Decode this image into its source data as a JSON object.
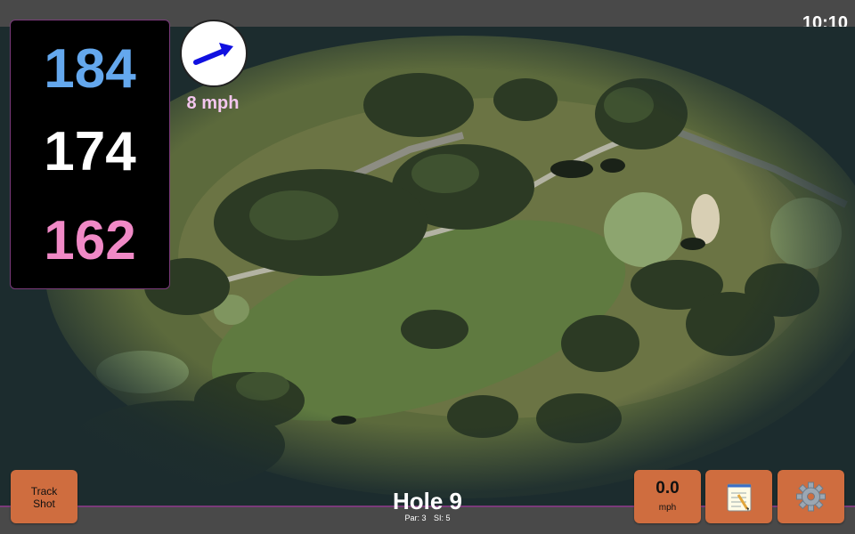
{
  "status": {
    "time": "10:10"
  },
  "distances": {
    "back": "184",
    "middle": "174",
    "front": "162"
  },
  "wind": {
    "speed_label": "8 mph",
    "direction_icon": "arrow-up-right-icon",
    "arrow_color": "#1010e0"
  },
  "hole": {
    "title": "Hole 9",
    "par_label": "Par: 3",
    "si_label": "SI: 5"
  },
  "buttons": {
    "track_shot_label": "Track\nShot",
    "speed_value": "0.0",
    "speed_unit": "mph",
    "notes_icon": "notepad-icon",
    "settings_icon": "gear-icon"
  },
  "colors": {
    "back": "#64a8ee",
    "middle": "#ffffff",
    "front": "#f089c6",
    "button": "#cf6d3f",
    "bar": "#494949"
  }
}
